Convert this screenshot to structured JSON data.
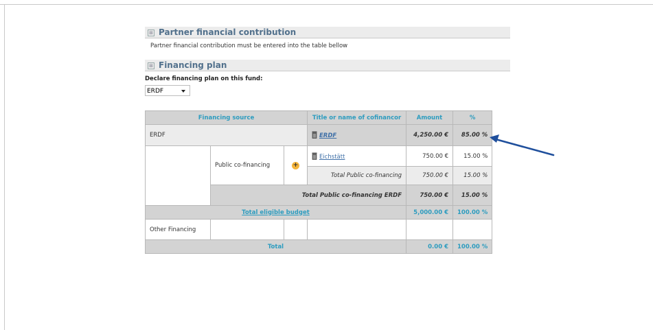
{
  "sections": {
    "partner": {
      "title": "Partner financial contribution",
      "toggle": "⊞",
      "text": "Partner financial contribution must be entered into the table bellow"
    },
    "plan": {
      "title": "Financing plan",
      "toggle": "⊞"
    }
  },
  "declare": {
    "label": "Declare financing plan on this fund:",
    "selected": "ERDF"
  },
  "table": {
    "headers": {
      "source": "Financing source",
      "title": "Title or name of cofinancor",
      "amount": "Amount",
      "pct": "%"
    },
    "erdf_row": {
      "source": "ERDF",
      "link": "ERDF",
      "amount": "4,250.00 €",
      "pct": "85.00 %"
    },
    "public": {
      "label": "Public co-financing",
      "plus": "+",
      "cofinancer": "Eichstätt",
      "amount": "750.00 €",
      "pct": "15.00 %",
      "subtotal_label": "Total Public co-financing",
      "subtotal_amount": "750.00 €",
      "subtotal_pct": "15.00 %",
      "erdf_total_label": "Total Public co-financing ERDF",
      "erdf_total_amount": "750.00 €",
      "erdf_total_pct": "15.00 %"
    },
    "eligible": {
      "label": "Total eligible budget",
      "amount": "5,000.00 €",
      "pct": "100.00 %"
    },
    "other": {
      "label": "Other Financing"
    },
    "total": {
      "label": "Total",
      "amount": "0.00 €",
      "pct": "100.00 %"
    }
  },
  "colors": {
    "header_text": "#2d9cbf",
    "section_title": "#51708c",
    "arrow": "#1f4f9c"
  },
  "icons": [
    "bin-icon",
    "add-icon",
    "arrow-icon",
    "expand-icon",
    "chevron-down-icon"
  ]
}
